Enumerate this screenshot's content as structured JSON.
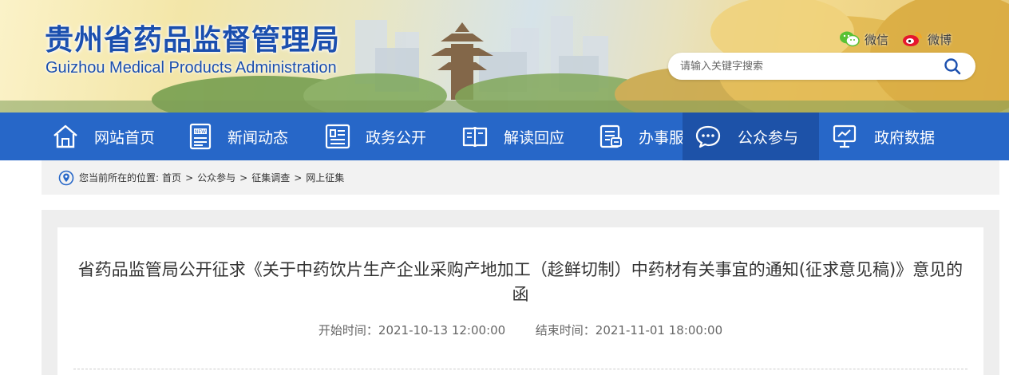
{
  "header": {
    "title": "贵州省药品监督管理局",
    "subtitle": "Guizhou Medical Products Administration",
    "social": [
      {
        "label": "微信",
        "icon": "wechat-icon"
      },
      {
        "label": "微博",
        "icon": "weibo-icon"
      }
    ],
    "search": {
      "placeholder": "请输入关键字搜索",
      "icon": "search-icon"
    }
  },
  "nav": {
    "items": [
      {
        "label": "网站首页",
        "icon": "home-icon",
        "active": false
      },
      {
        "label": "新闻动态",
        "icon": "news-icon",
        "active": false
      },
      {
        "label": "政务公开",
        "icon": "document-icon",
        "active": false
      },
      {
        "label": "解读回应",
        "icon": "book-icon",
        "active": false
      },
      {
        "label": "办事服务",
        "icon": "service-icon",
        "active": false
      },
      {
        "label": "公众参与",
        "icon": "chat-icon",
        "active": true
      },
      {
        "label": "政府数据",
        "icon": "data-monitor-icon",
        "active": false
      }
    ]
  },
  "breadcrumb": {
    "prefix": "您当前所在的位置:",
    "items": [
      "首页",
      "公众参与",
      "征集调查",
      "网上征集"
    ],
    "separator": ">"
  },
  "article": {
    "title": "省药品监管局公开征求《关于中药饮片生产企业采购产地加工（趁鲜切制）中药材有关事宜的通知(征求意见稿)》意见的函",
    "start_label": "开始时间：",
    "start_time": "2021-10-13 12:00:00",
    "end_label": "结束时间：",
    "end_time": "2021-11-01 18:00:00"
  },
  "colors": {
    "nav_bg": "#2767c8",
    "nav_active_bg": "#1d52a8",
    "title_blue": "#1b4fae",
    "breadcrumb_bg": "#f2f2f2",
    "content_bg": "#eeeeee"
  }
}
